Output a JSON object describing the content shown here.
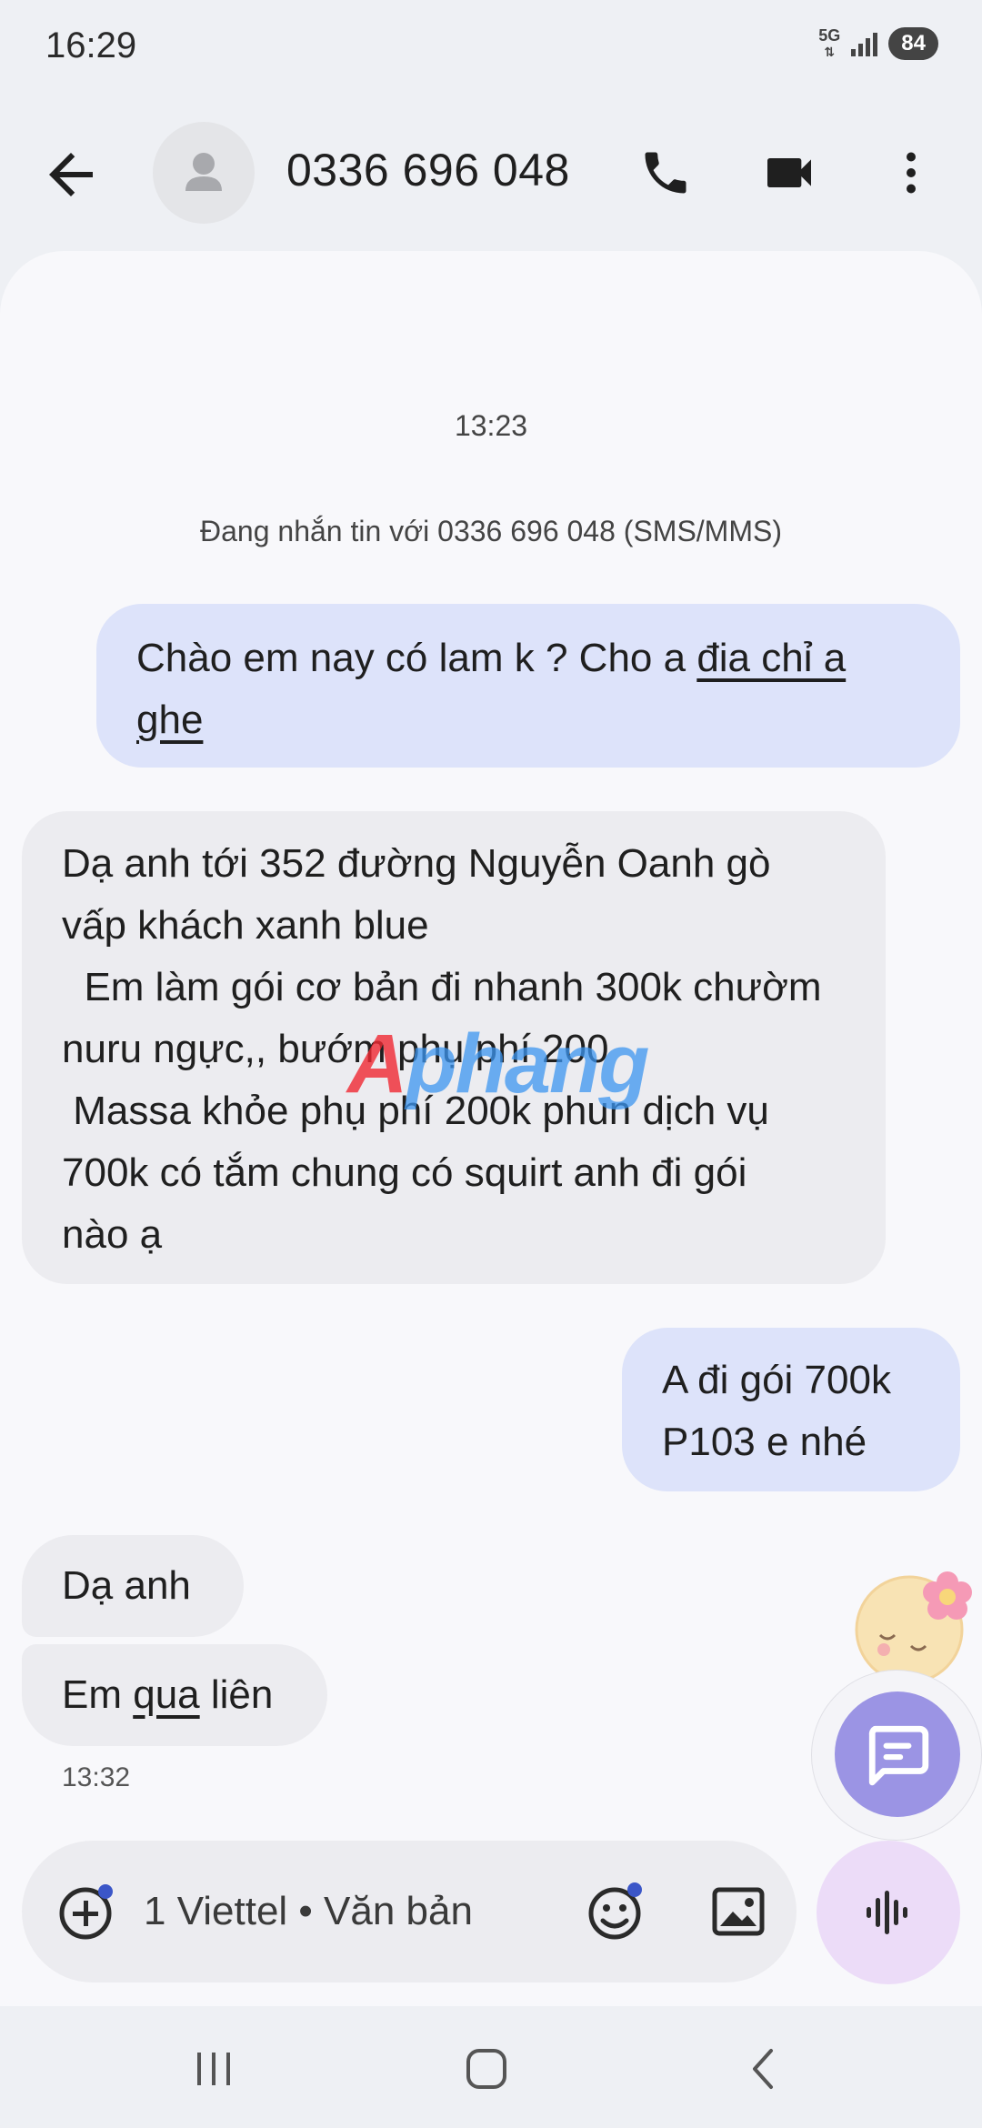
{
  "status_bar": {
    "time": "16:29",
    "network": "5G",
    "battery": "84"
  },
  "header": {
    "contact": "0336 696 048",
    "icons": [
      "back-arrow-icon",
      "avatar-person-icon",
      "phone-icon",
      "video-camera-icon",
      "more-vert-icon"
    ]
  },
  "conversation": {
    "start_time": "13:23",
    "info": "Đang nhắn tin với 0336 696 048 (SMS/MMS)",
    "messages": [
      {
        "direction": "outgoing",
        "text_plain": "Chào em nay có lam k ? Cho a ",
        "text_link": "đia chỉ a\nghe"
      },
      {
        "direction": "incoming",
        "text": "Dạ anh tới 352 đường Nguyễn Oanh gò\nvấp khách xanh blue\n  Em làm gói cơ bản đi nhanh 300k chườm\nnuru ngực,, bướm phụ phí 200\n Massa khỏe phụ phí 200k phun dịch vụ\n700k có tắm chung có squirt anh đi gói\nnào ạ"
      },
      {
        "direction": "outgoing",
        "text": "A đi gói 700k\nP103 e nhé"
      },
      {
        "direction": "incoming",
        "text": "Dạ anh"
      },
      {
        "direction": "incoming",
        "text_before": "Em ",
        "text_link": "qua",
        "text_after": " liên"
      }
    ],
    "last_time": "13:32"
  },
  "watermark": {
    "part1": "A",
    "part2": "phang"
  },
  "compose": {
    "placeholder": "1 Viettel • Văn bản",
    "icons": [
      "add-circle-icon",
      "emoji-icon",
      "gallery-icon",
      "voice-waveform-icon"
    ]
  },
  "nav": {
    "icons": [
      "recent-apps-icon",
      "home-icon",
      "back-icon"
    ]
  },
  "colors": {
    "outgoing_bubble": "#dde3fa",
    "incoming_bubble": "#ececf0",
    "chat_fab": "#9b94e4",
    "voice_button": "#ecdcf8"
  }
}
